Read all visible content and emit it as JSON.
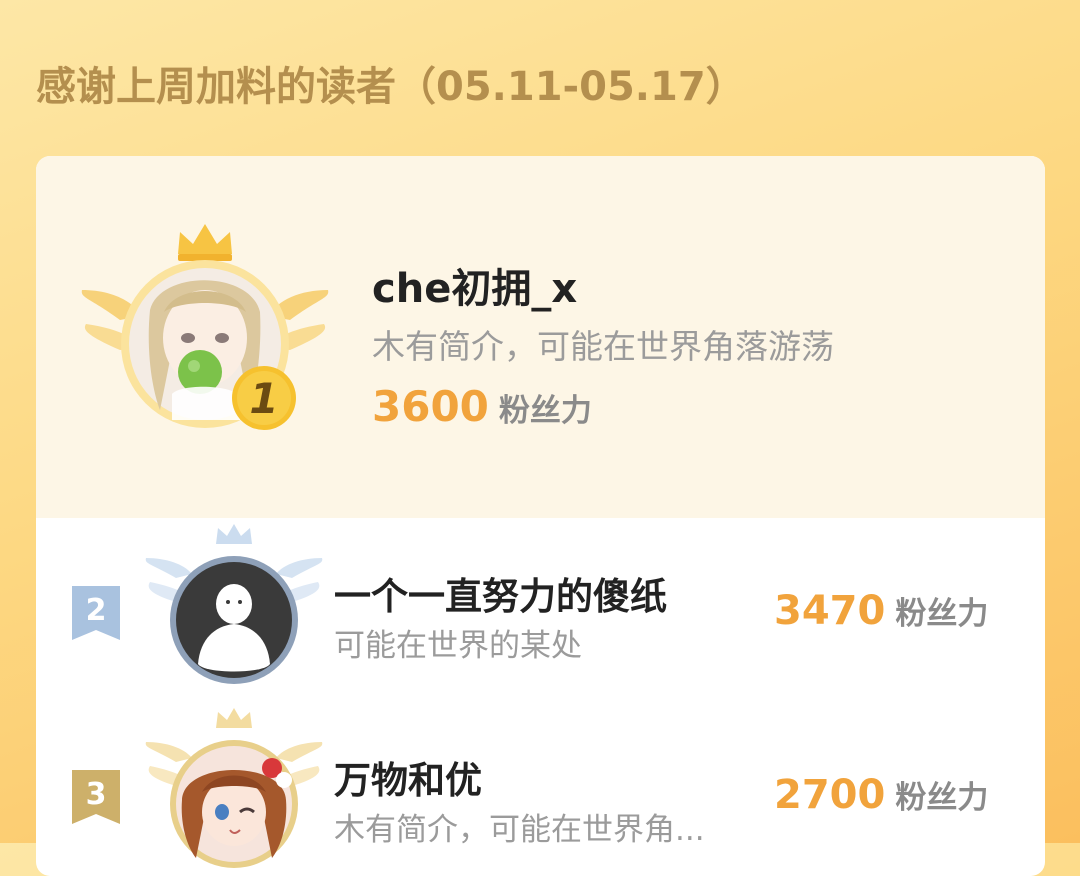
{
  "header": {
    "title": "感谢上周加料的读者（05.11-05.17）"
  },
  "colors": {
    "accent": "#f1a33c",
    "title": "#b48f4e",
    "gold": "#f7c443",
    "silver": "#a9c2df"
  },
  "leaderboard": {
    "first": {
      "rank": "1",
      "name": "che初拥_x",
      "bio": "木有简介，可能在世界角落游荡",
      "score": "3600",
      "unit": "粉丝力"
    },
    "rows": [
      {
        "rank": "2",
        "name": "一个一直努力的傻纸",
        "bio": "可能在世界的某处",
        "score": "3470",
        "unit": "粉丝力"
      },
      {
        "rank": "3",
        "name": "万物和优",
        "bio": "木有简介，可能在世界角...",
        "score": "2700",
        "unit": "粉丝力"
      }
    ]
  }
}
